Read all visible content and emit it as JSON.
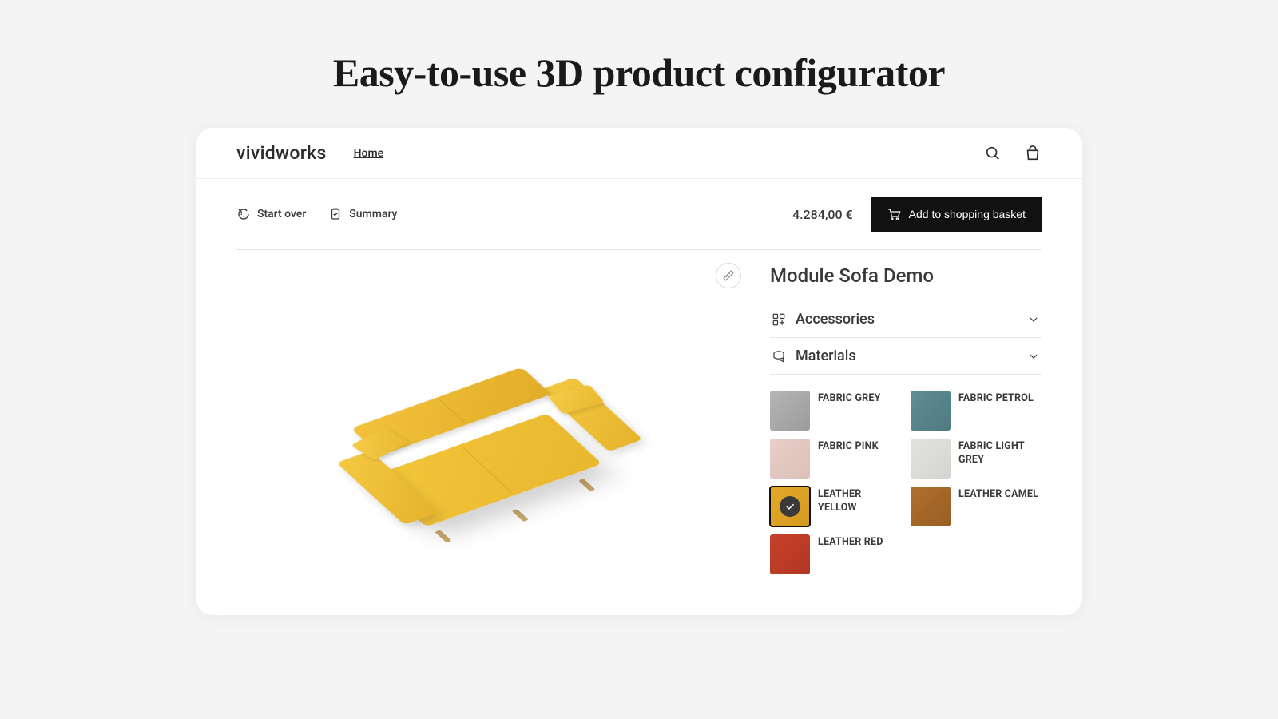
{
  "headline": "Easy-to-use 3D product configurator",
  "brand": "vividworks",
  "nav": {
    "home": "Home"
  },
  "actions": {
    "start_over": "Start over",
    "summary": "Summary",
    "price": "4.284,00 €",
    "add_to_basket": "Add to shopping basket"
  },
  "product": {
    "title": "Module Sofa Demo"
  },
  "sections": {
    "accessories": "Accessories",
    "materials": "Materials"
  },
  "swatches": [
    {
      "key": "fabric_grey",
      "label": "FABRIC GREY",
      "cls": "c-grey",
      "selected": false
    },
    {
      "key": "fabric_petrol",
      "label": "FABRIC PETROL",
      "cls": "c-petrol",
      "selected": false
    },
    {
      "key": "fabric_pink",
      "label": "FABRIC PINK",
      "cls": "c-pink",
      "selected": false
    },
    {
      "key": "fabric_light_grey",
      "label": "FABRIC LIGHT GREY",
      "cls": "c-lightgrey",
      "selected": false
    },
    {
      "key": "leather_yellow",
      "label": "LEATHER YELLOW",
      "cls": "c-leatheryellow",
      "selected": true
    },
    {
      "key": "leather_camel",
      "label": "LEATHER CAMEL",
      "cls": "c-camel",
      "selected": false
    },
    {
      "key": "leather_red",
      "label": "LEATHER RED",
      "cls": "c-red",
      "selected": false
    }
  ]
}
